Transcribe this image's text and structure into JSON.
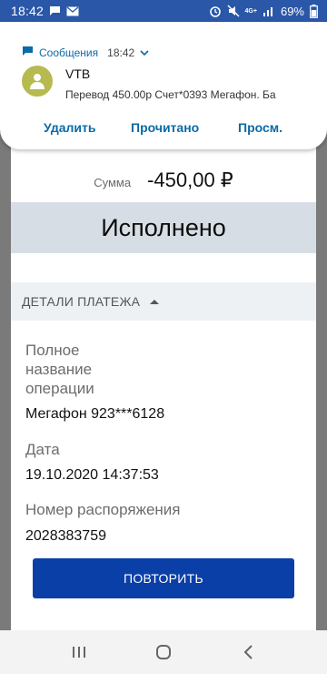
{
  "status_bar": {
    "time": "18:42",
    "battery": "69%",
    "network": "4G+"
  },
  "notification": {
    "app_name": "Сообщения",
    "time": "18:42",
    "sender": "VTB",
    "text": "Перевод 450.00р Счет*0393 Мегафон. Ба",
    "actions": [
      "Удалить",
      "Прочитано",
      "Просм."
    ]
  },
  "payment": {
    "amount_label": "Сумма",
    "amount_value": "-450,00 ₽",
    "status": "Исполнено",
    "details_title": "ДЕТАЛИ ПЛАТЕЖА",
    "fields": [
      {
        "label": "Полное название операции",
        "value": "Мегафон 923***6128"
      },
      {
        "label": "Дата",
        "value": "19.10.2020 14:37:53"
      },
      {
        "label": "Номер распоряжения",
        "value": "2028383759"
      }
    ],
    "repeat_label": "ПОВТОРИТЬ"
  },
  "colors": {
    "status_bar": "#2a57a8",
    "accent": "#0a3fa8",
    "notification_accent": "#0b6aa8",
    "status_band": "#d7dde4"
  },
  "icons": {
    "notif_app": "message-icon",
    "avatar": "person-icon",
    "nav": [
      "recents-icon",
      "home-icon",
      "back-icon"
    ]
  }
}
